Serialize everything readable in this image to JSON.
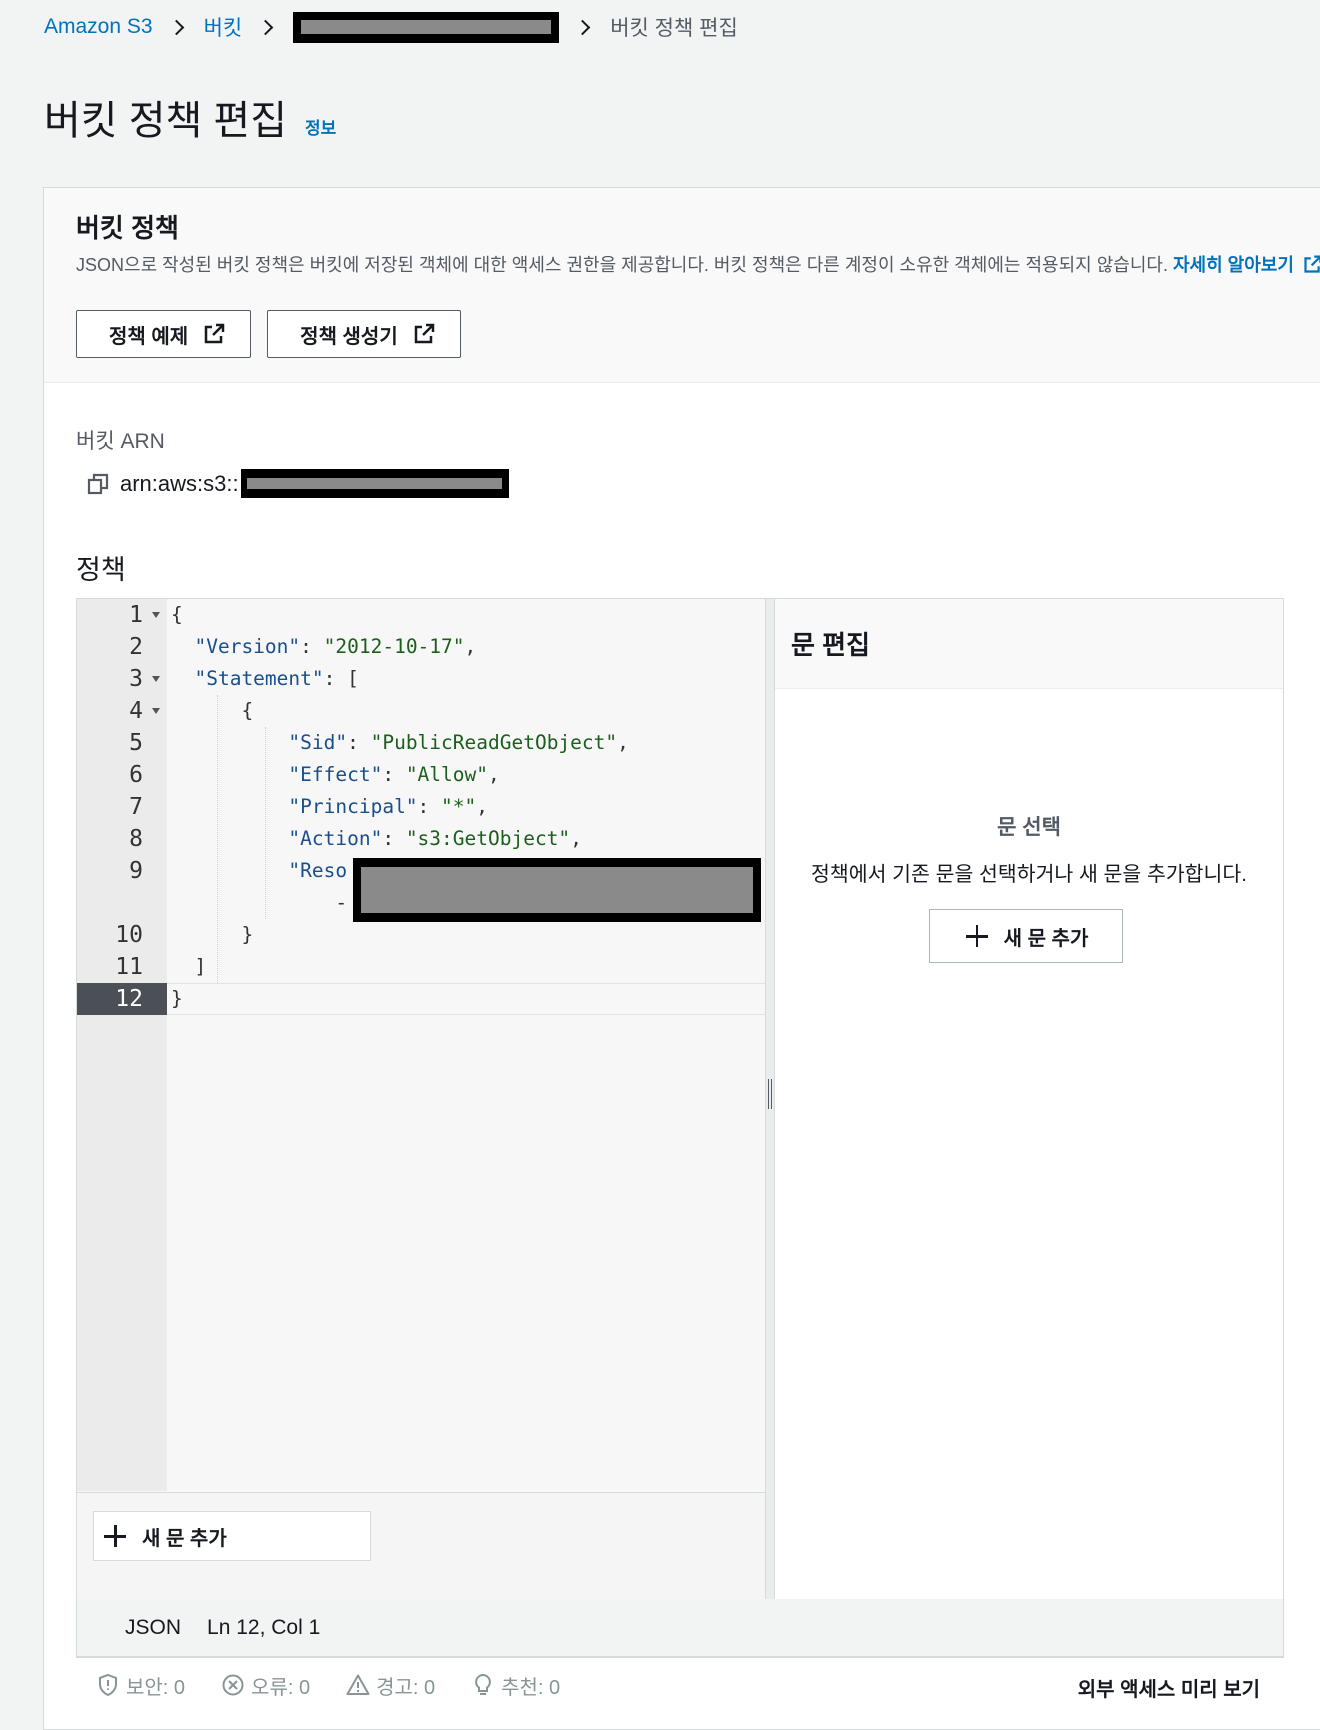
{
  "breadcrumb": {
    "root": "Amazon S3",
    "buckets": "버킷",
    "current": "버킷 정책 편집"
  },
  "page": {
    "title": "버킷 정책 편집",
    "info": "정보"
  },
  "section": {
    "title": "버킷 정책",
    "description": "JSON으로 작성된 버킷 정책은 버킷에 저장된 객체에 대한 액세스 권한을 제공합니다. 버킷 정책은 다른 계정이 소유한 객체에는 적용되지 않습니다.",
    "learn_more": "자세히 알아보기",
    "examples_button": "정책 예제",
    "generator_button": "정책 생성기"
  },
  "arn": {
    "label": "버킷 ARN",
    "prefix": "arn:aws:s3::"
  },
  "policy_label": "정책",
  "editor": {
    "lines": [
      "1",
      "2",
      "3",
      "4",
      "5",
      "6",
      "7",
      "8",
      "9",
      "10",
      "11",
      "12"
    ],
    "add_statement": "새 문 추가",
    "active_line": "12"
  },
  "statement_panel": {
    "title": "문 편집",
    "empty_title": "문 선택",
    "empty_desc": "정책에서 기존 문을 선택하거나 새 문을 추가합니다.",
    "add_button": "새 문 추가"
  },
  "status": {
    "language": "JSON",
    "position": "Ln 12, Col 1"
  },
  "validation": {
    "security": "보안: 0",
    "errors": "오류: 0",
    "warnings": "경고: 0",
    "suggestions": "추천: 0",
    "preview": "외부 액세스 미리 보기"
  },
  "colors": {
    "link": "#0073bb",
    "json_key": "#1a4f8b",
    "json_string": "#1c5f1c"
  }
}
